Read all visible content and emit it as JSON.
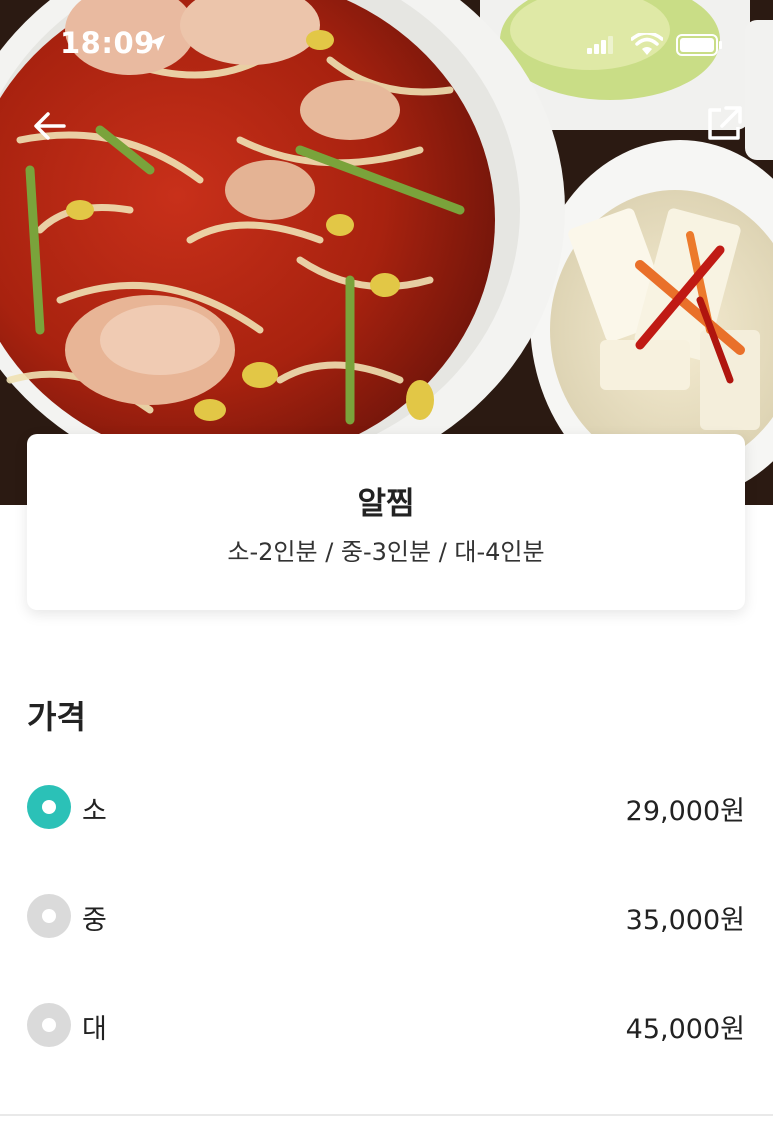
{
  "status_bar": {
    "time": "18:09"
  },
  "icons": {
    "back": "arrow-left-icon",
    "share": "external-share-icon",
    "location": "location-arrow-icon",
    "signal": "cellular-signal-icon",
    "wifi": "wifi-icon",
    "battery": "battery-icon"
  },
  "menu": {
    "name": "알찜",
    "description": "소-2인분 / 중-3인분 / 대-4인분"
  },
  "price_section": {
    "title": "가격",
    "options": [
      {
        "label": "소",
        "price": "29,000원",
        "selected": true
      },
      {
        "label": "중",
        "price": "35,000원",
        "selected": false
      },
      {
        "label": "대",
        "price": "45,000원",
        "selected": false
      }
    ]
  },
  "colors": {
    "accent": "#2bc1b7",
    "radio_unselected": "#dadada"
  }
}
